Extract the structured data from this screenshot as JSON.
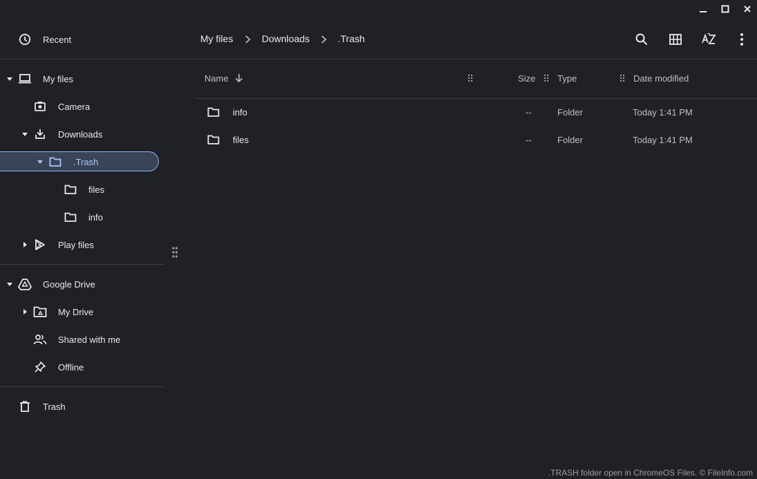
{
  "window_controls": {
    "minimize": "minimize",
    "maximize": "maximize",
    "close": "close"
  },
  "sidebar": {
    "recent": "Recent",
    "my_files": "My files",
    "camera": "Camera",
    "downloads": "Downloads",
    "trash_folder": ".Trash",
    "files": "files",
    "info": "info",
    "play_files": "Play files",
    "google_drive": "Google Drive",
    "my_drive": "My Drive",
    "shared_with_me": "Shared with me",
    "offline": "Offline",
    "trash": "Trash"
  },
  "breadcrumb": [
    "My files",
    "Downloads",
    ".Trash"
  ],
  "toolbar": {
    "search": "search-icon",
    "grid": "grid-view-icon",
    "sort": "sort-az-icon",
    "more": "more-vert-icon"
  },
  "table": {
    "columns": {
      "name": "Name",
      "size": "Size",
      "type": "Type",
      "date": "Date modified"
    },
    "rows": [
      {
        "name": "info",
        "size": "--",
        "type": "Folder",
        "date": "Today 1:41 PM"
      },
      {
        "name": "files",
        "size": "--",
        "type": "Folder",
        "date": "Today 1:41 PM"
      }
    ]
  },
  "footer": ".TRASH folder open in ChromeOS Files. © FileInfo.com",
  "colors": {
    "background": "#202124",
    "selected": "#394457",
    "accent": "#8ab4f8",
    "text": "#e8eaed"
  }
}
